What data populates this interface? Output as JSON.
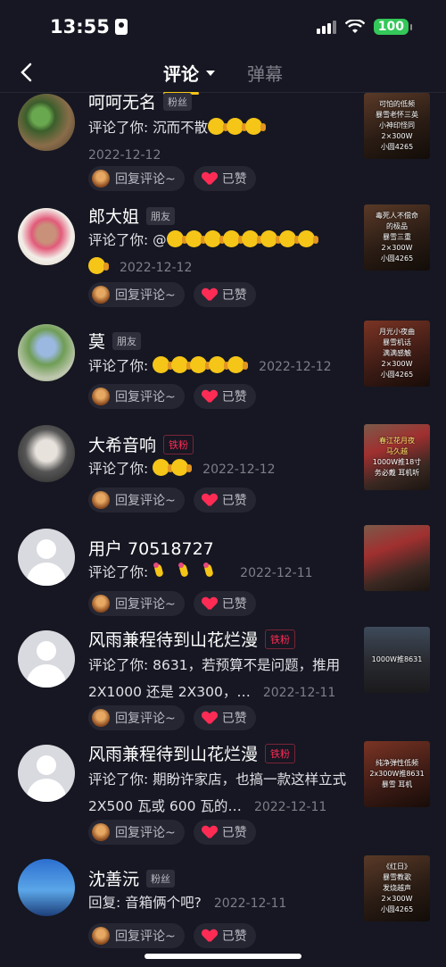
{
  "status_bar": {
    "time": "13:55",
    "battery": "100"
  },
  "nav": {
    "active_tab": "评论",
    "inactive_tab": "弹幕"
  },
  "actions": {
    "reply_label": "回复评论~",
    "liked_label": "已赞"
  },
  "comments": [
    {
      "name": "呵呵无名",
      "badge": "粉丝",
      "badge_type": "plain",
      "prefix": "评论了你: 沉而不散",
      "emoji_count": 3,
      "date": "2022-12-12",
      "thumb_lines": [
        "可怕的低频",
        "暴雪老怀三英",
        "小神印怪同",
        "2×300W",
        "小圆4265"
      ]
    },
    {
      "name": "郎大姐",
      "badge": "朋友",
      "badge_type": "plain",
      "prefix": "评论了你: @",
      "emoji_count": 9,
      "date": "2022-12-12",
      "thumb_lines": [
        "毒死人不偿命",
        "的极品",
        "暴雪三重",
        "2×300W",
        "小圆4265"
      ]
    },
    {
      "name": "莫",
      "badge": "朋友",
      "badge_type": "plain",
      "prefix": "评论了你: ",
      "emoji_count": 5,
      "date": "2022-12-12",
      "thumb_lines": [
        "月光小夜曲",
        "暴雪机话",
        "满满感触",
        "2×300W",
        "小圆4265"
      ]
    },
    {
      "name": "大希音响",
      "badge": "铁粉",
      "badge_type": "fan",
      "prefix": "评论了你: ",
      "emoji_count": 2,
      "date": "2022-12-12",
      "thumb_lines": [
        "春江花月夜",
        "马久越",
        "1000W推18寸",
        "务必戴  耳机听"
      ]
    },
    {
      "name": "用户 70518727",
      "badge": "",
      "badge_type": "none",
      "prefix": "评论了你: ",
      "emoji_count": 3,
      "date": "2022-12-11",
      "thumb_lines": []
    },
    {
      "name": "风雨兼程待到山花烂漫",
      "badge": "铁粉",
      "badge_type": "fan",
      "prefix": "评论了你: 8631，若预算不是问题，推用 2X1000 还是 2X300，…",
      "emoji_count": 0,
      "date": "2022-12-11",
      "thumb_lines": [
        "1000W推8631"
      ]
    },
    {
      "name": "风雨兼程待到山花烂漫",
      "badge": "铁粉",
      "badge_type": "fan",
      "prefix": "评论了你: 期盼许家店，也搞一款这样立式 2X500 瓦或 600 瓦的…",
      "emoji_count": 0,
      "date": "2022-12-11",
      "thumb_lines": [
        "纯净弹性低频",
        "2x300W推8631",
        "暴雪  耳机"
      ]
    },
    {
      "name": "沈善沅",
      "badge": "粉丝",
      "badge_type": "plain",
      "prefix": "回复: 音箱俩个吧?",
      "emoji_count": 0,
      "date": "2022-12-11",
      "thumb_lines": [
        "《红日》",
        "暴雪教歌",
        "发烧越声",
        "2×300W",
        "小圆4265"
      ]
    }
  ]
}
